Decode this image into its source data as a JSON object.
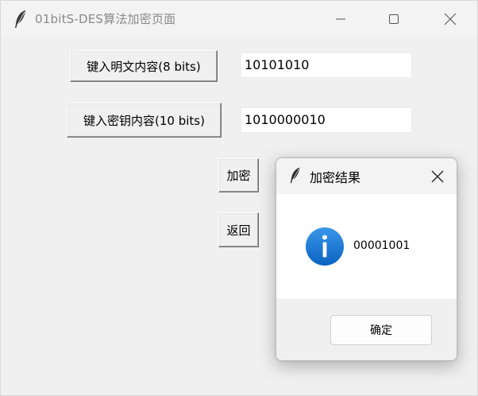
{
  "window": {
    "title": "01bitS-DES算法加密页面",
    "icon": "feather-icon",
    "controls": [
      "minimize-icon",
      "maximize-icon",
      "close-icon"
    ]
  },
  "form": {
    "plaintext_button_label": "键入明文内容(8 bits)",
    "plaintext_value": "10101010",
    "key_button_label": "键入密钥内容(10 bits)",
    "key_value": "1010000010",
    "encrypt_button_label": "加密",
    "back_button_label": "返回"
  },
  "dialog": {
    "title": "加密结果",
    "icon": "feather-icon",
    "message_icon": "info-icon",
    "message": "00001001",
    "ok_label": "确定"
  },
  "colors": {
    "window_bg": "#f0f0f0",
    "info_blue": "#1a73d6"
  }
}
